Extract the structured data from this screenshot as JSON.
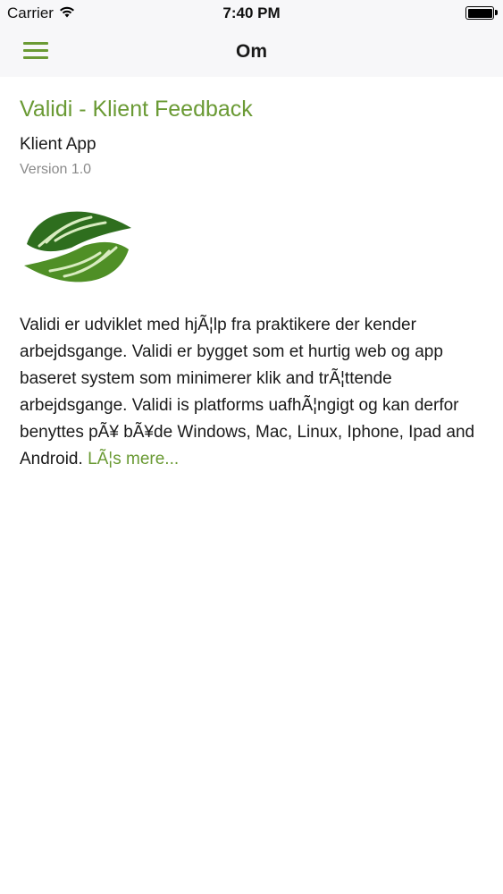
{
  "status_bar": {
    "carrier": "Carrier",
    "time": "7:40 PM",
    "battery_level": 1.0
  },
  "nav": {
    "title": "Om",
    "menu_icon": "hamburger-icon"
  },
  "about": {
    "app_name": "Validi - Klient Feedback",
    "subtitle": "Klient App",
    "version": "Version 1.0",
    "logo_icon": "hands-leaf-logo",
    "description": "Validi er udviklet med hjÃ¦lp fra praktikere der kender arbejdsgange. Validi er bygget som et hurtig web og app baseret system som minimerer klik and trÃ¦ttende arbejdsgange. Validi is platforms uafhÃ¦ngigt og kan derfor benyttes pÃ¥ bÃ¥de Windows, Mac, Linux, Iphone, Ipad and Android.",
    "read_more": "LÃ¦s mere..."
  },
  "colors": {
    "accent": "#6a9a34",
    "logo_dark": "#2e6e1e",
    "logo_light": "#5c9a2c"
  }
}
